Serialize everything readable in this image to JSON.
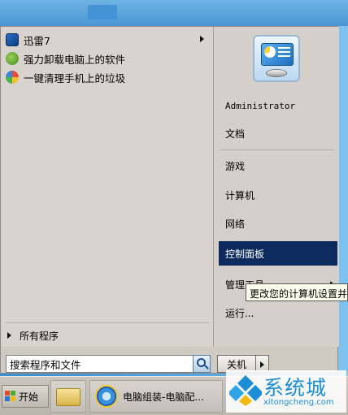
{
  "programs": [
    {
      "label": "迅雷7",
      "icon": "thunder-icon",
      "has_submenu": true
    },
    {
      "label": "强力卸载电脑上的软件",
      "icon": "uninstall-icon",
      "has_submenu": false
    },
    {
      "label": "一键清理手机上的垃圾",
      "icon": "cleanup-icon",
      "has_submenu": false
    }
  ],
  "all_programs_label": "所有程序",
  "search": {
    "text": "搜索程序和文件"
  },
  "user": {
    "name": "Administrator"
  },
  "right_items": {
    "documents": "文档",
    "games": "游戏",
    "computer": "计算机",
    "network": "网络",
    "control_panel": "控制面板",
    "admin_tools": "管理工具",
    "run": "运行..."
  },
  "tooltip": "更改您的计算机设置并",
  "shutdown_label": "关机",
  "taskbar": {
    "start_label": "开始",
    "ie_window_title": "电脑组装-电脑配..."
  },
  "watermark": {
    "brand": "系统城",
    "url": "xitongcheng.com"
  },
  "colors": {
    "highlight": "#0c2a5e",
    "menu_bg": "#d8d4cd",
    "watermark": "#1b8ed6"
  }
}
